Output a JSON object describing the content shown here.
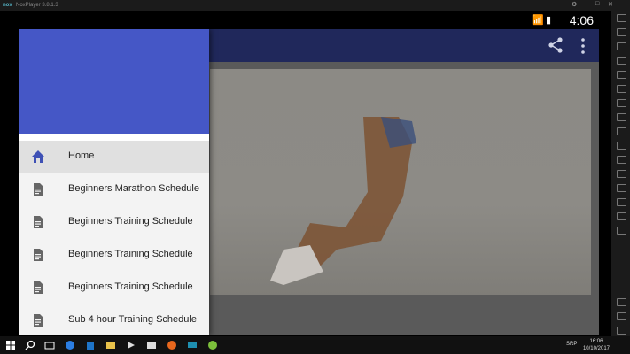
{
  "emulator": {
    "brand": "nox",
    "title": "NoxPlayer 3.8.1.3",
    "window_controls": [
      "settings-icon",
      "minimize-icon",
      "restore-icon",
      "close-icon"
    ]
  },
  "status_bar": {
    "time": "4:06",
    "icons": [
      "wifi-icon",
      "signal-icon",
      "battery-icon"
    ]
  },
  "app_bar": {
    "background": "#20285b",
    "actions": [
      "share-icon",
      "more-vert-icon"
    ]
  },
  "drawer": {
    "header_color": "#4557c6",
    "items": [
      {
        "label": "Home",
        "icon": "home-icon",
        "selected": true
      },
      {
        "label": "Beginners Marathon Schedule",
        "icon": "document-icon",
        "selected": false
      },
      {
        "label": "Beginners Training Schedule",
        "icon": "document-icon",
        "selected": false
      },
      {
        "label": "Beginners Training Schedule",
        "icon": "document-icon",
        "selected": false
      },
      {
        "label": "Beginners Training Schedule",
        "icon": "document-icon",
        "selected": false
      },
      {
        "label": "Sub 4 hour Training Schedule",
        "icon": "document-icon",
        "selected": false
      }
    ]
  },
  "taskbar": {
    "language": "SRP",
    "time": "16:06",
    "date": "10/10/2017"
  }
}
